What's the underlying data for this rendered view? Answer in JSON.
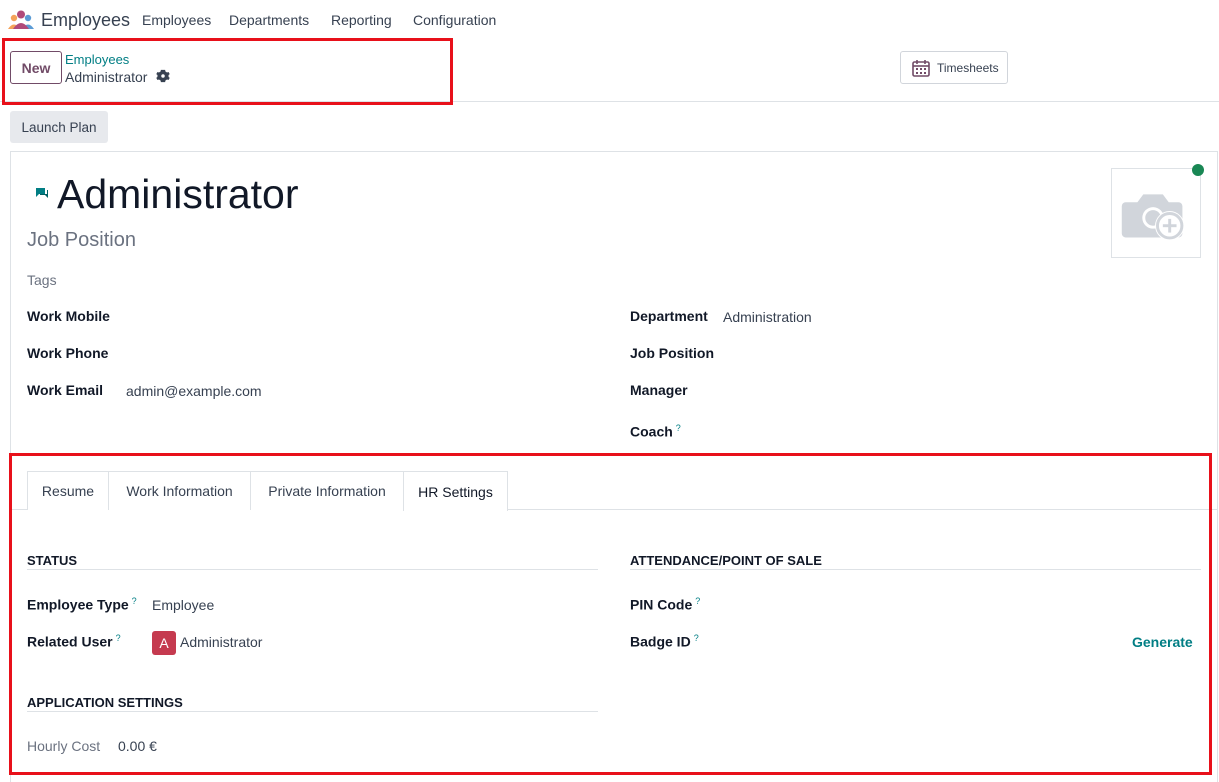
{
  "navbar": {
    "app_name": "Employees",
    "menu": [
      "Employees",
      "Departments",
      "Reporting",
      "Configuration"
    ]
  },
  "control_panel": {
    "new_label": "New",
    "breadcrumb_parent": "Employees",
    "breadcrumb_current": "Administrator",
    "timesheets_label": "Timesheets"
  },
  "statusbar": {
    "launch_plan_label": "Launch Plan"
  },
  "employee": {
    "name": "Administrator",
    "job_title_placeholder": "Job Position",
    "tags_placeholder": "Tags",
    "status_color": "#198754"
  },
  "fields_left": [
    {
      "label": "Work Mobile",
      "value": ""
    },
    {
      "label": "Work Phone",
      "value": ""
    },
    {
      "label": "Work Email",
      "value": "admin@example.com"
    }
  ],
  "fields_right": [
    {
      "label": "Department",
      "value": "Administration"
    },
    {
      "label": "Job Position",
      "value": ""
    },
    {
      "label": "Manager",
      "value": ""
    },
    {
      "label": "Coach",
      "value": "",
      "help": "?"
    }
  ],
  "tabs": [
    "Resume",
    "Work Information",
    "Private Information",
    "HR Settings"
  ],
  "active_tab": "HR Settings",
  "hr_settings": {
    "status_title": "STATUS",
    "employee_type_label": "Employee Type",
    "employee_type_value": "Employee",
    "related_user_label": "Related User",
    "related_user_initial": "A",
    "related_user_value": "Administrator",
    "attendance_title": "ATTENDANCE/POINT OF SALE",
    "pin_code_label": "PIN Code",
    "badge_id_label": "Badge ID",
    "generate_label": "Generate",
    "application_title": "APPLICATION SETTINGS",
    "hourly_cost_label": "Hourly Cost",
    "hourly_cost_value": "0.00 €",
    "help_mark": "?"
  },
  "colors": {
    "brand": "#714B67",
    "link": "#017e84",
    "annotation": "#e8101a"
  }
}
